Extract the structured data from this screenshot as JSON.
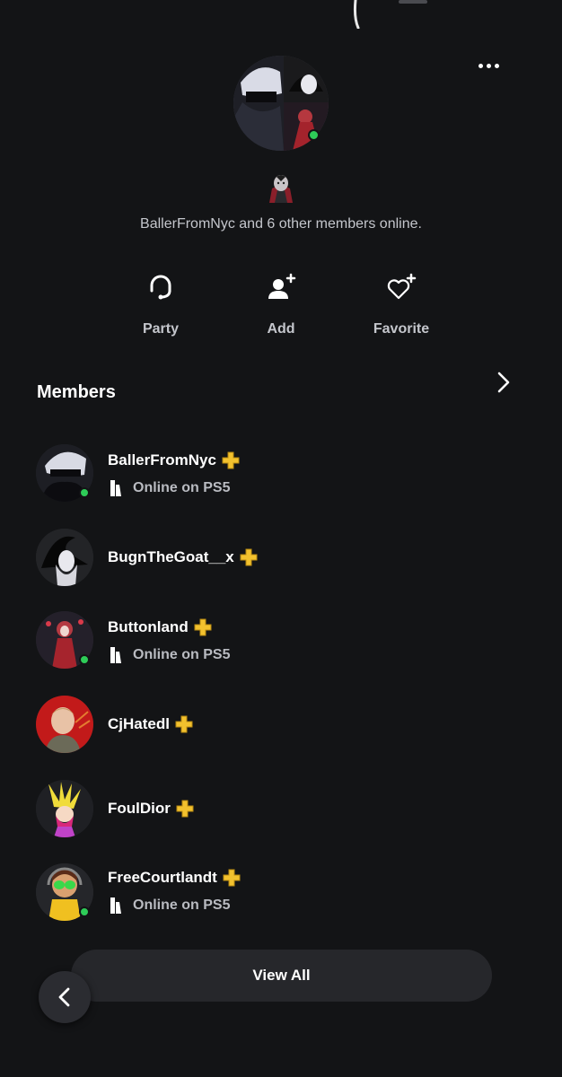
{
  "group": {
    "online_summary": "BallerFromNyc and 6 other members online.",
    "avatar_icon": "group-collage-avatar",
    "emoji_icon": "vampire-emoji-icon"
  },
  "actions": [
    {
      "label": "Party",
      "icon": "headset-icon"
    },
    {
      "label": "Add",
      "icon": "add-user-icon"
    },
    {
      "label": "Favorite",
      "icon": "heart-plus-icon"
    }
  ],
  "members_section": {
    "title": "Members",
    "view_all_label": "View All"
  },
  "members": [
    {
      "name": "BallerFromNyc",
      "status": "Online on PS5",
      "online": true,
      "ps_plus": true
    },
    {
      "name": "BugnTheGoat__x",
      "status": "",
      "online": false,
      "ps_plus": true
    },
    {
      "name": "Buttonland",
      "status": "Online on PS5",
      "online": true,
      "ps_plus": true
    },
    {
      "name": "CjHatedl",
      "status": "",
      "online": false,
      "ps_plus": true
    },
    {
      "name": "FoulDior",
      "status": "",
      "online": false,
      "ps_plus": true
    },
    {
      "name": "FreeCourtlandt",
      "status": "Online on PS5",
      "online": true,
      "ps_plus": true
    }
  ],
  "colors": {
    "background": "#131416",
    "online": "#2ecc58",
    "ps_plus": "#f2c12e",
    "button": "#26272b"
  }
}
